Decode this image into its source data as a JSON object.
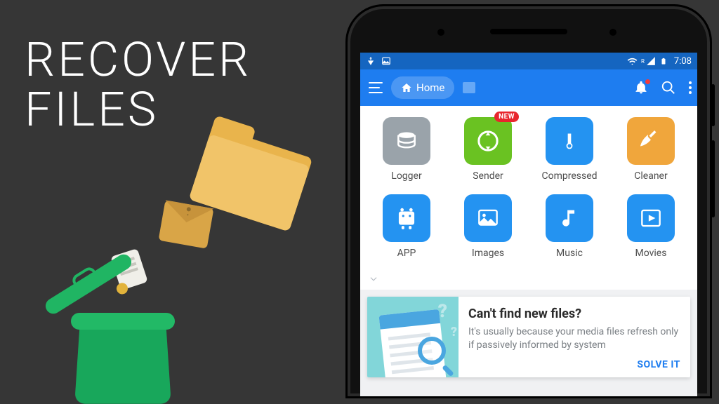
{
  "headline_l1": "RECOVER",
  "headline_l2": "FILES",
  "status": {
    "time": "7:08",
    "signal_label": "R"
  },
  "appbar": {
    "breadcrumb": "Home"
  },
  "tiles": [
    {
      "label": "Logger"
    },
    {
      "label": "Sender",
      "badge": "NEW"
    },
    {
      "label": "Compressed"
    },
    {
      "label": "Cleaner"
    },
    {
      "label": "APP"
    },
    {
      "label": "Images"
    },
    {
      "label": "Music"
    },
    {
      "label": "Movies"
    }
  ],
  "card": {
    "title": "Can't find new files?",
    "body": "It's usually because your media files refresh only if passively informed by system",
    "cta": "SOLVE IT"
  }
}
